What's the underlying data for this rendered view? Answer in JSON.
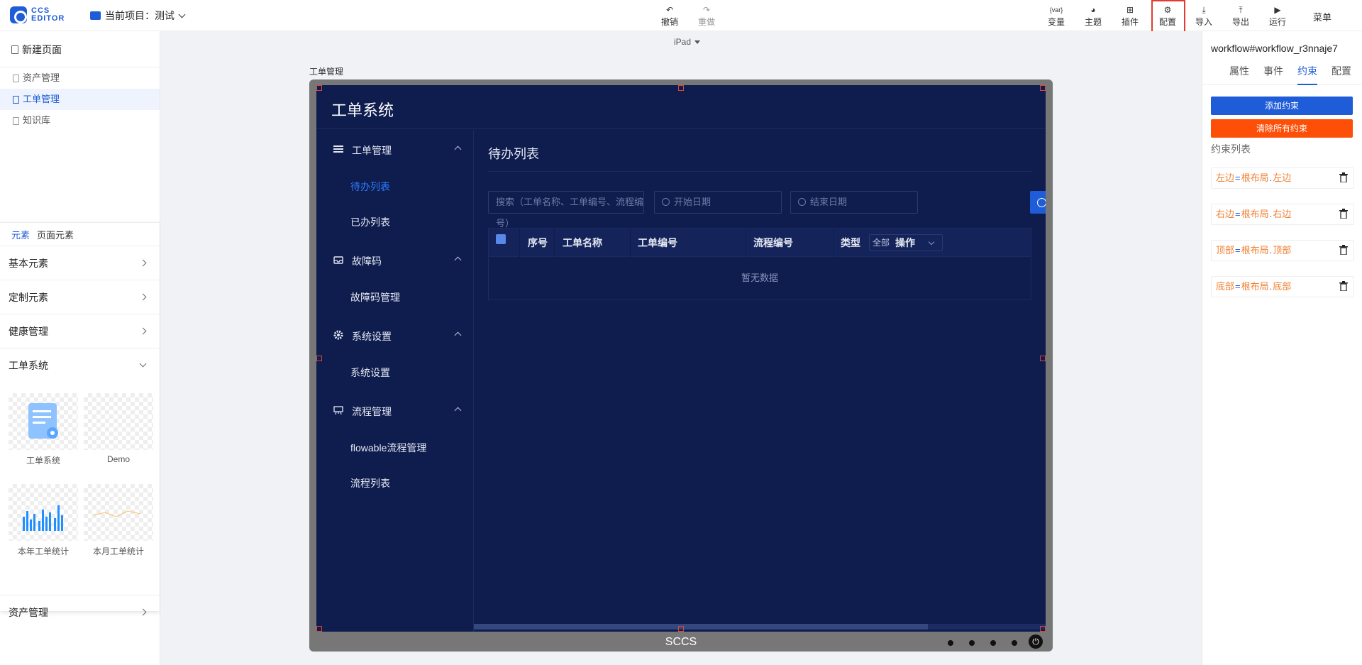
{
  "app": {
    "logo_line1": "CCS",
    "logo_line2": "EDITOR"
  },
  "project": {
    "label": "当前项目：测试"
  },
  "toolbar": {
    "undo": "撤销",
    "redo": "重做",
    "variables": "变量",
    "variables_icon": "{var}",
    "theme": "主题",
    "plugins": "插件",
    "config": "配置",
    "import": "导入",
    "export": "导出",
    "run": "运行",
    "menu": "菜单"
  },
  "left": {
    "new_page": "新建页面",
    "pages": [
      {
        "label": "资产管理"
      },
      {
        "label": "工单管理",
        "active": true
      },
      {
        "label": "知识库"
      }
    ],
    "tabs": [
      "元素",
      "页面元素"
    ],
    "categories": [
      {
        "label": "基本元素"
      },
      {
        "label": "定制元素"
      },
      {
        "label": "健康管理"
      },
      {
        "label": "工单系统"
      }
    ],
    "thumbs": [
      {
        "label": "工单系统"
      },
      {
        "label": "Demo"
      },
      {
        "label": "本年工单统计"
      },
      {
        "label": "本月工单统计"
      }
    ],
    "last_category": "资产管理"
  },
  "canvas": {
    "device": "iPad",
    "page_label": "工单管理",
    "device_brand": "SCCS"
  },
  "inner_app": {
    "title": "工单系统",
    "nav": [
      {
        "label": "工单管理",
        "icon": "menu-icon",
        "children": [
          {
            "label": "待办列表",
            "active": true
          },
          {
            "label": "已办列表"
          }
        ]
      },
      {
        "label": "故障码",
        "icon": "inbox-icon",
        "children": [
          {
            "label": "故障码管理"
          }
        ]
      },
      {
        "label": "系统设置",
        "icon": "gear-icon",
        "children": [
          {
            "label": "系统设置"
          }
        ]
      },
      {
        "label": "流程管理",
        "icon": "easel-icon",
        "children": [
          {
            "label": "flowable流程管理"
          },
          {
            "label": "流程列表"
          }
        ]
      }
    ],
    "content": {
      "title": "待办列表",
      "search_placeholder": "搜索（工单名称、工单编号、流程编号）",
      "start_date": "开始日期",
      "end_date": "结束日期",
      "columns": [
        "序号",
        "工单名称",
        "工单编号",
        "流程编号",
        "类型"
      ],
      "filter_value": "全部",
      "ops_column": "操作",
      "empty_text": "暂无数据"
    }
  },
  "right": {
    "workflow_name": "workflow#workflow_r3nnaje7",
    "tabs": [
      "属性",
      "事件",
      "约束",
      "配置"
    ],
    "active_tab": "约束",
    "add_button": "添加约束",
    "clear_button": "清除所有约束",
    "list_title": "约束列表",
    "constraints": [
      {
        "left": "左边",
        "eq": "=",
        "ref": "根布局",
        "dot": ".",
        "target": "左边"
      },
      {
        "left": "右边",
        "eq": "=",
        "ref": "根布局",
        "dot": ".",
        "target": "右边"
      },
      {
        "left": "顶部",
        "eq": "=",
        "ref": "根布局",
        "dot": ".",
        "target": "顶部"
      },
      {
        "left": "底部",
        "eq": "=",
        "ref": "根布局",
        "dot": ".",
        "target": "底部"
      }
    ]
  },
  "colors": {
    "accent": "#1e5cd8",
    "danger": "#fe4f08",
    "canvas_bg": "#0e1c4e"
  }
}
